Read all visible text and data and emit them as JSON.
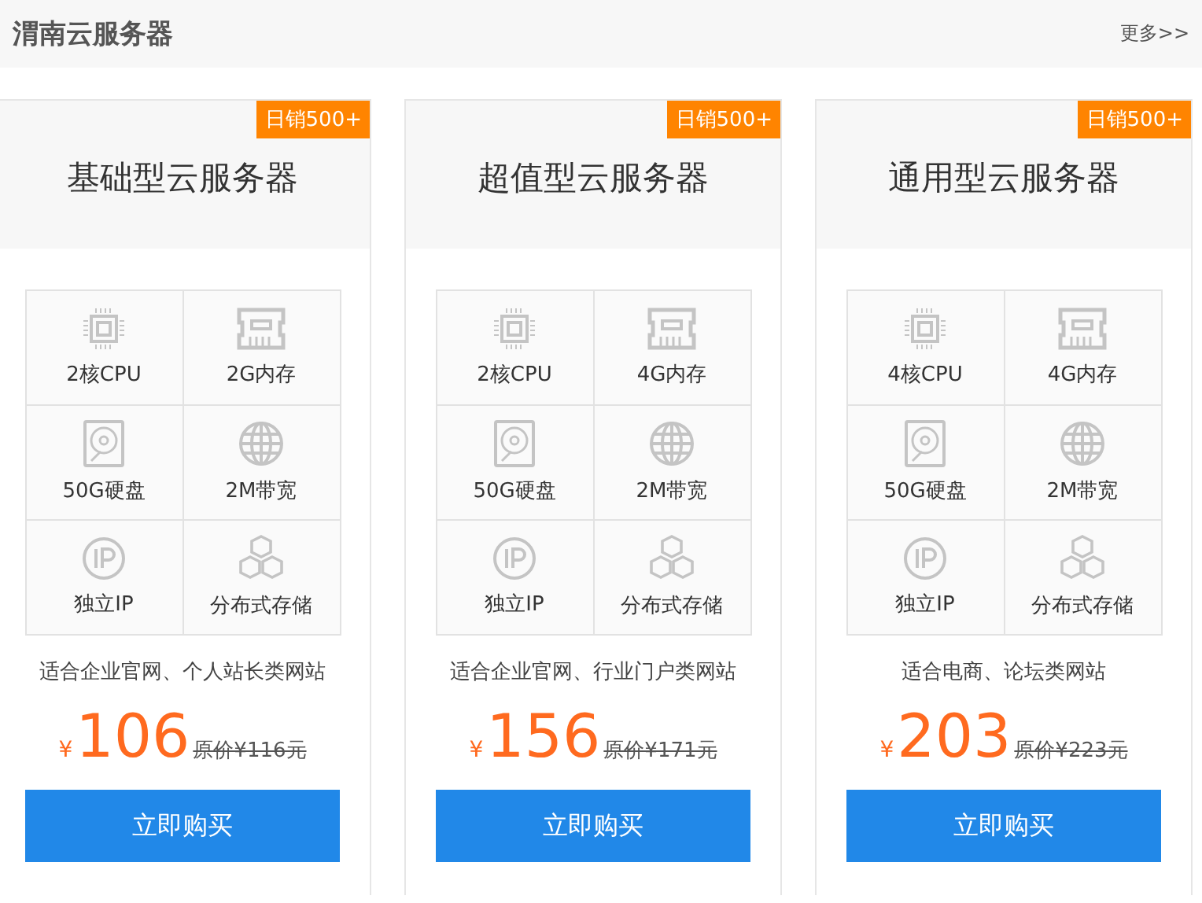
{
  "header": {
    "title": "渭南云服务器",
    "more_link": "更多>>"
  },
  "cards": [
    {
      "badge": "日销500+",
      "title": "基础型云服务器",
      "specs": [
        {
          "kind": "cpu",
          "label": "2核CPU"
        },
        {
          "kind": "memory",
          "label": "2G内存"
        },
        {
          "kind": "disk",
          "label": "50G硬盘"
        },
        {
          "kind": "bandwidth",
          "label": "2M带宽"
        },
        {
          "kind": "ip",
          "label": "独立IP"
        },
        {
          "kind": "storage",
          "label": "分布式存储"
        }
      ],
      "description": "适合企业官网、个人站长类网站",
      "currency": "¥",
      "price": "106",
      "original_price": "原价¥116元",
      "button": "立即购买"
    },
    {
      "badge": "日销500+",
      "title": "超值型云服务器",
      "specs": [
        {
          "kind": "cpu",
          "label": "2核CPU"
        },
        {
          "kind": "memory",
          "label": "4G内存"
        },
        {
          "kind": "disk",
          "label": "50G硬盘"
        },
        {
          "kind": "bandwidth",
          "label": "2M带宽"
        },
        {
          "kind": "ip",
          "label": "独立IP"
        },
        {
          "kind": "storage",
          "label": "分布式存储"
        }
      ],
      "description": "适合企业官网、行业门户类网站",
      "currency": "¥",
      "price": "156",
      "original_price": "原价¥171元",
      "button": "立即购买"
    },
    {
      "badge": "日销500+",
      "title": "通用型云服务器",
      "specs": [
        {
          "kind": "cpu",
          "label": "4核CPU"
        },
        {
          "kind": "memory",
          "label": "4G内存"
        },
        {
          "kind": "disk",
          "label": "50G硬盘"
        },
        {
          "kind": "bandwidth",
          "label": "2M带宽"
        },
        {
          "kind": "ip",
          "label": "独立IP"
        },
        {
          "kind": "storage",
          "label": "分布式存储"
        }
      ],
      "description": "适合电商、论坛类网站",
      "currency": "¥",
      "price": "203",
      "original_price": "原价¥223元",
      "button": "立即购买"
    }
  ]
}
